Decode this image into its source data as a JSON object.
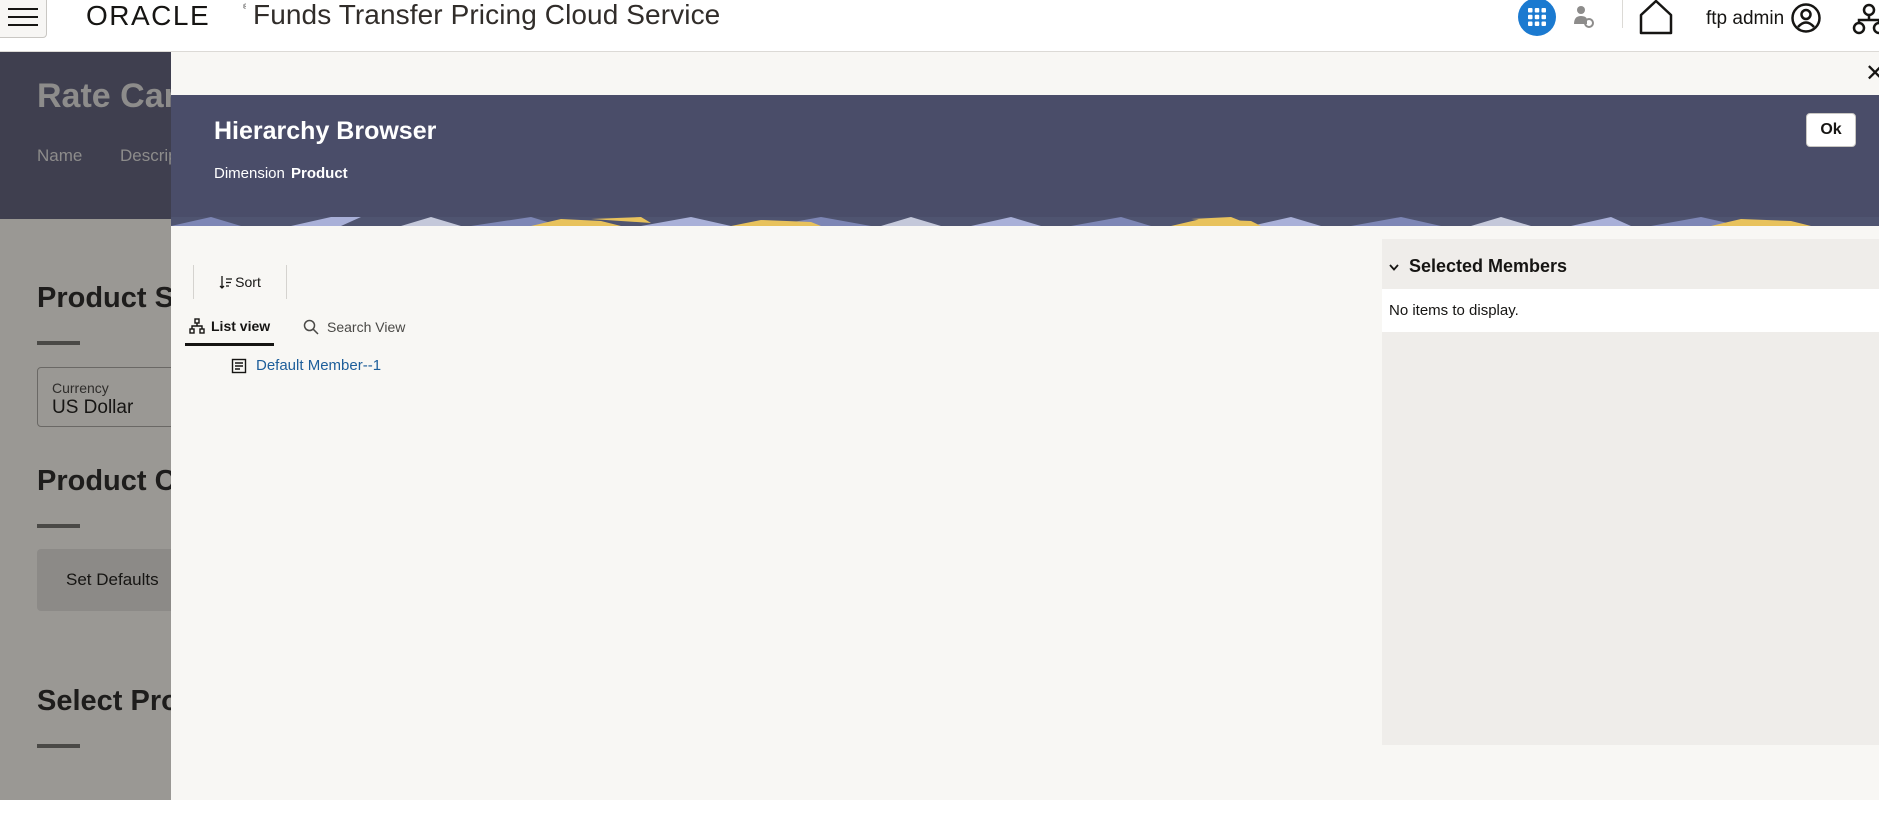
{
  "header": {
    "app_title": "Funds Transfer Pricing Cloud Service",
    "user_name": "ftp admin",
    "icons": [
      "hamburger-menu-icon",
      "apps-grid-icon",
      "person-gear-icon",
      "home-icon",
      "user-avatar-icon",
      "network-icon"
    ],
    "accent_color": "#1b7ad0"
  },
  "background_page": {
    "title": "Rate Car",
    "tabs": [
      "Name",
      "Descrip"
    ],
    "sections": [
      "Product S",
      "Product C",
      "Select Pro"
    ],
    "currency_field": {
      "label": "Currency",
      "value": "US Dollar"
    },
    "set_defaults_label": "Set Defaults"
  },
  "dialog": {
    "title": "Hierarchy Browser",
    "dimension_label": "Dimension",
    "dimension_value": "Product",
    "ok_label": "Ok",
    "close_symbol": "✕",
    "header_color": "#4a4d69",
    "sort_label": "Sort",
    "tabs": {
      "list_view": "List view",
      "search_view": "Search View"
    },
    "tree_items": [
      {
        "label": "Default Member--1"
      }
    ],
    "selected_members": {
      "title": "Selected Members",
      "empty_text": "No items to display."
    }
  }
}
